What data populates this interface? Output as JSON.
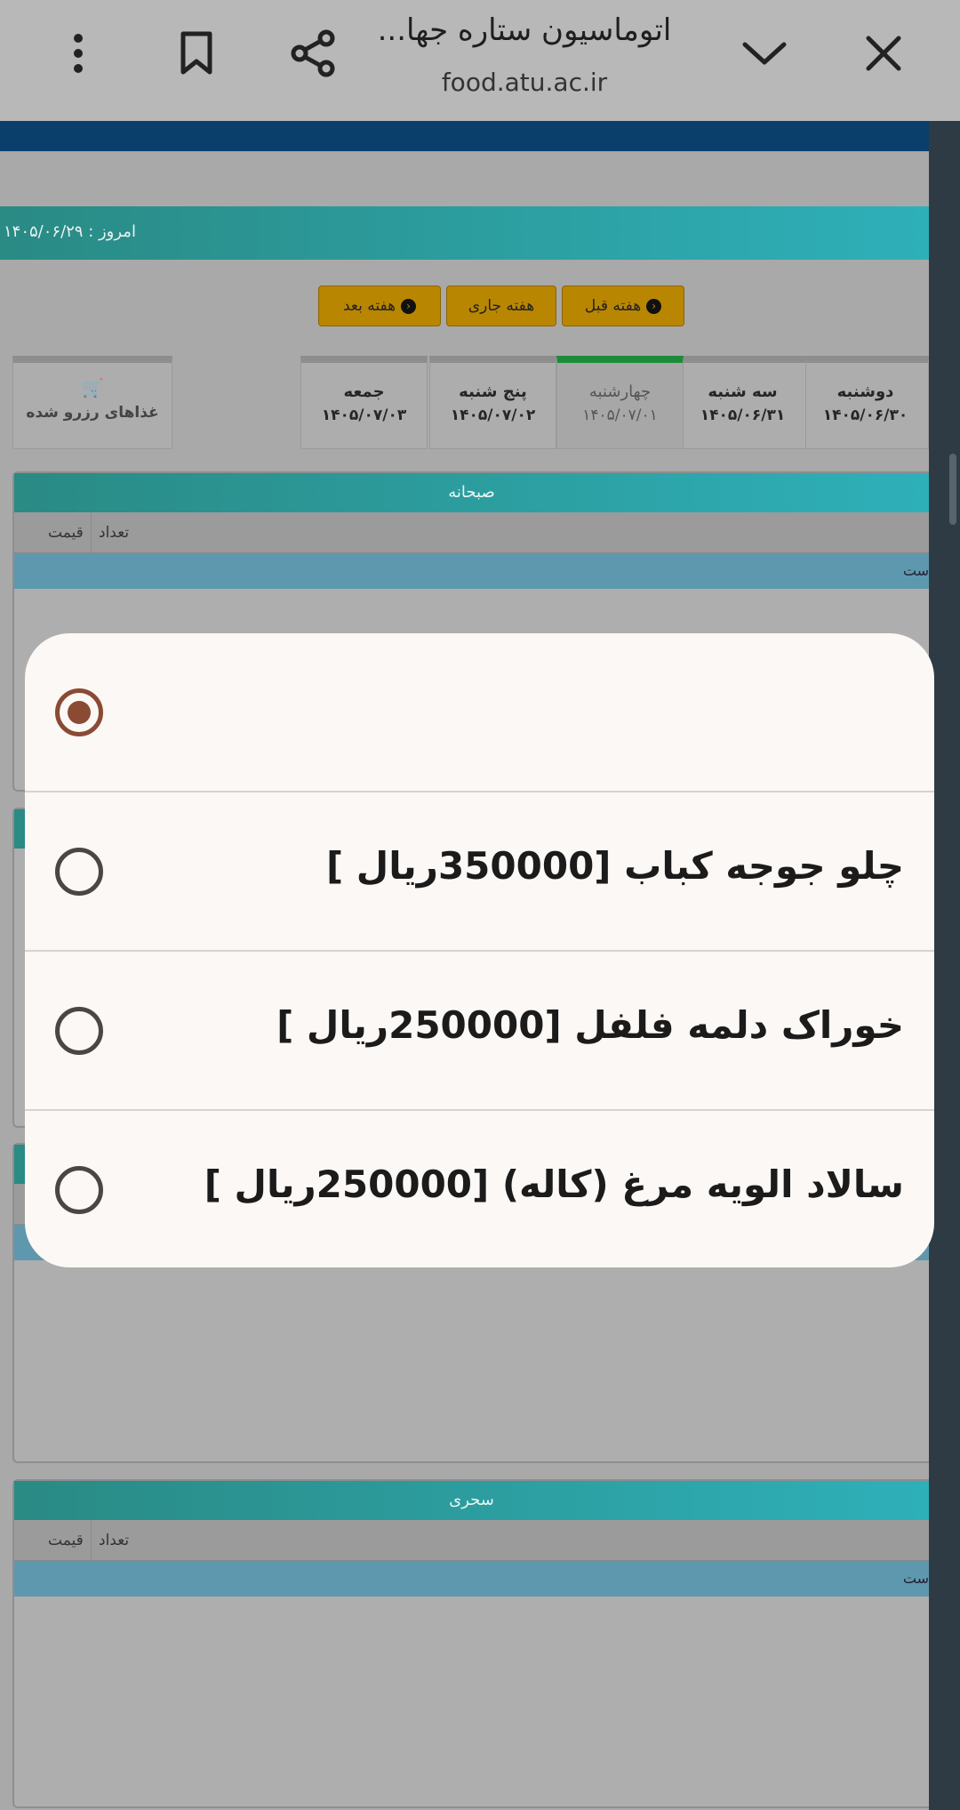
{
  "browser": {
    "title": "اتوماسیون ستاره جها...",
    "host": "food.atu.ac.ir",
    "icons": [
      "more-vert-icon",
      "bookmark-icon",
      "share-icon",
      "chevron-down-icon",
      "close-icon"
    ]
  },
  "page": {
    "today_label": "امروز : ۱۴۰۵/۰۶/۲۹",
    "week_nav": {
      "prev": "هفته قبل",
      "current": "هفته جاری",
      "next": "هفته بعد"
    },
    "days": [
      {
        "name": "دوشنبه",
        "date": "۱۴۰۵/۰۶/۳۰"
      },
      {
        "name": "سه شنبه",
        "date": "۱۴۰۵/۰۶/۳۱"
      },
      {
        "name": "چهارشنبه",
        "date": "۱۴۰۵/۰۷/۰۱",
        "active": true
      },
      {
        "name": "پنج شنبه",
        "date": "۱۴۰۵/۰۷/۰۲"
      },
      {
        "name": "جمعه",
        "date": "۱۴۰۵/۰۷/۰۳"
      }
    ],
    "reserved_label": "غذاهای رزرو شده",
    "panels": [
      {
        "title": "صبحانه",
        "col_count": "تعداد",
        "col_price": "قیمت",
        "row_fragment": "ست"
      },
      {
        "title": "سحری",
        "col_count": "تعداد",
        "col_price": "قیمت",
        "row_fragment": "ست"
      }
    ]
  },
  "dialog": {
    "options": [
      {
        "label": "",
        "selected": true
      },
      {
        "label": "چلو جوجه کباب [350000ریال ]",
        "selected": false
      },
      {
        "label": "خوراک دلمه فلفل [250000ریال ]",
        "selected": false
      },
      {
        "label": "سالاد الویه مرغ (کاله) [250000ریال ]",
        "selected": false
      }
    ]
  },
  "colors": {
    "accent_teal": "#2a8a84",
    "radio_selected": "#8a4a33",
    "dialog_bg": "#fcf8f5"
  }
}
